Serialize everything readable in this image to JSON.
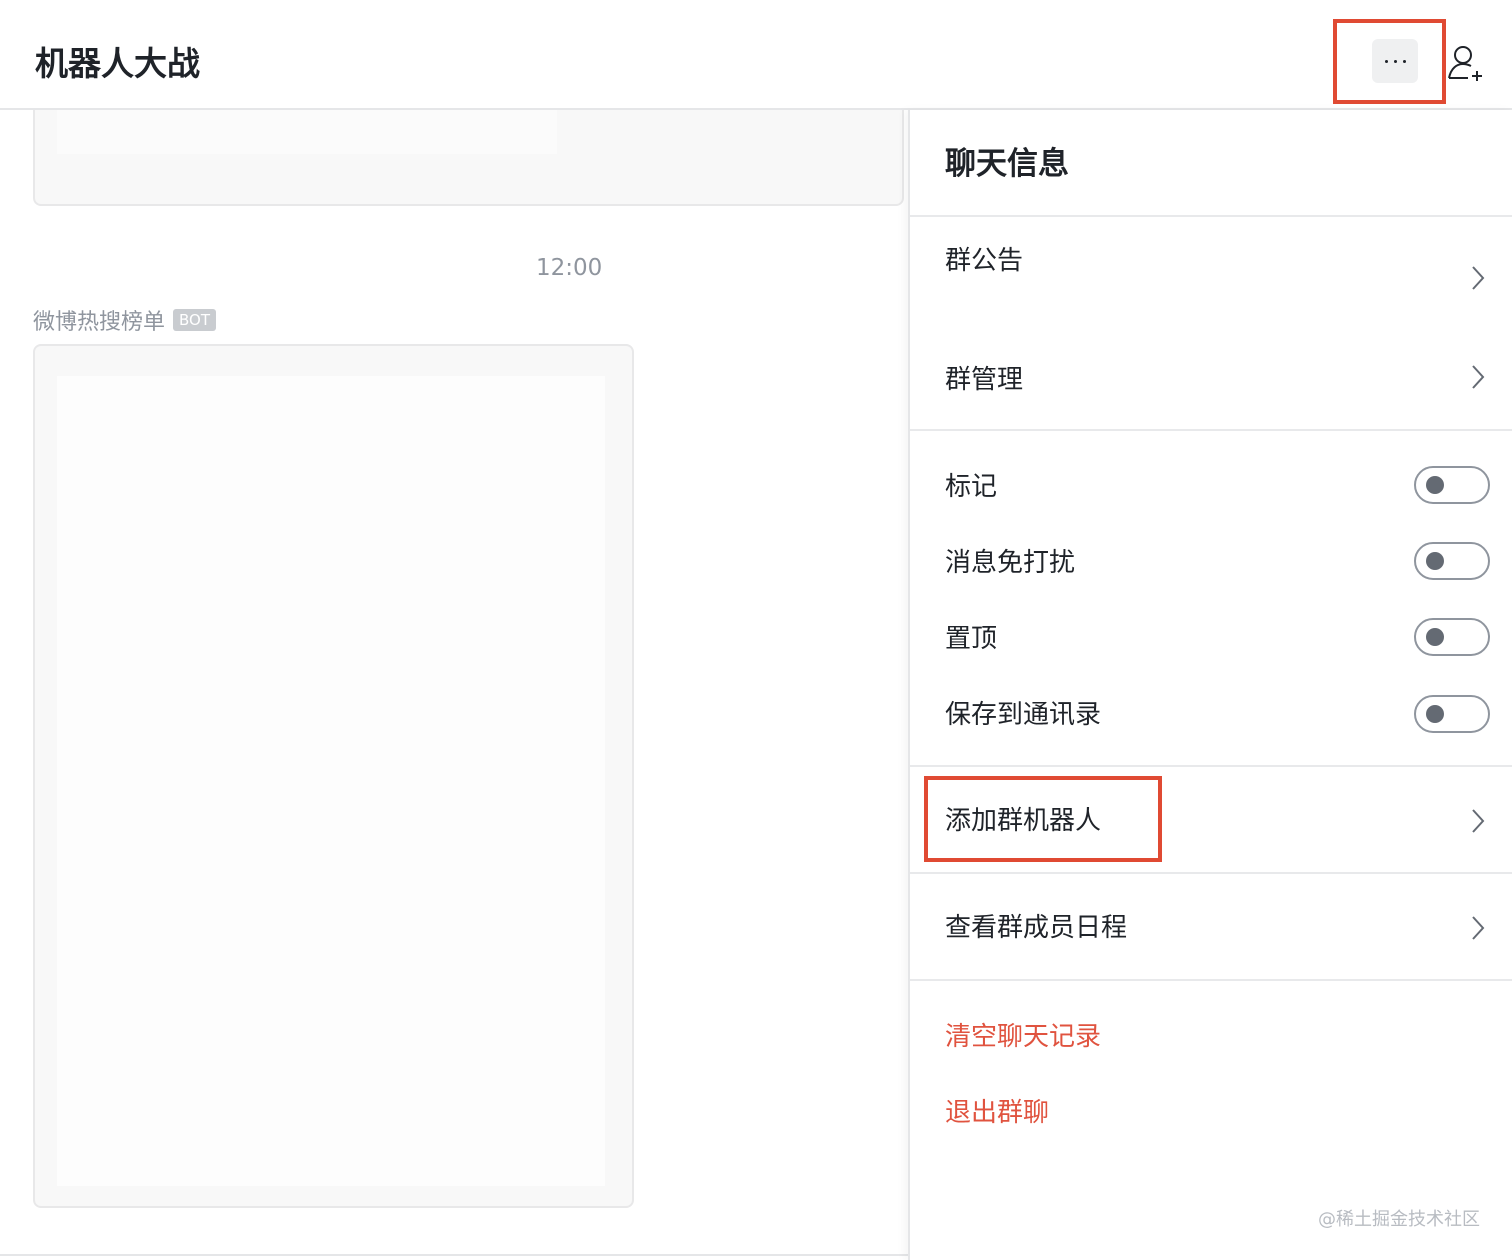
{
  "header": {
    "title": "机器人大战",
    "more_icon": "more-horizontal-icon",
    "add_member_icon": "add-member-icon"
  },
  "chat": {
    "time": "12:00",
    "sender_name": "微博热搜榜单",
    "sender_tag": "BOT"
  },
  "panel": {
    "title": "聊天信息",
    "nav_items": [
      {
        "label": "群公告"
      },
      {
        "label": "群管理"
      }
    ],
    "toggles": [
      {
        "label": "标记",
        "on": false
      },
      {
        "label": "消息免打扰",
        "on": false
      },
      {
        "label": "置顶",
        "on": false
      },
      {
        "label": "保存到通讯录",
        "on": false
      }
    ],
    "add_bot": {
      "label": "添加群机器人"
    },
    "schedule": {
      "label": "查看群成员日程"
    },
    "danger_items": [
      {
        "label": "清空聊天记录"
      },
      {
        "label": "退出群聊"
      }
    ]
  },
  "colors": {
    "accent_red": "#e04a33",
    "danger_text": "#e0533f"
  },
  "watermark": "@稀土掘金技术社区"
}
